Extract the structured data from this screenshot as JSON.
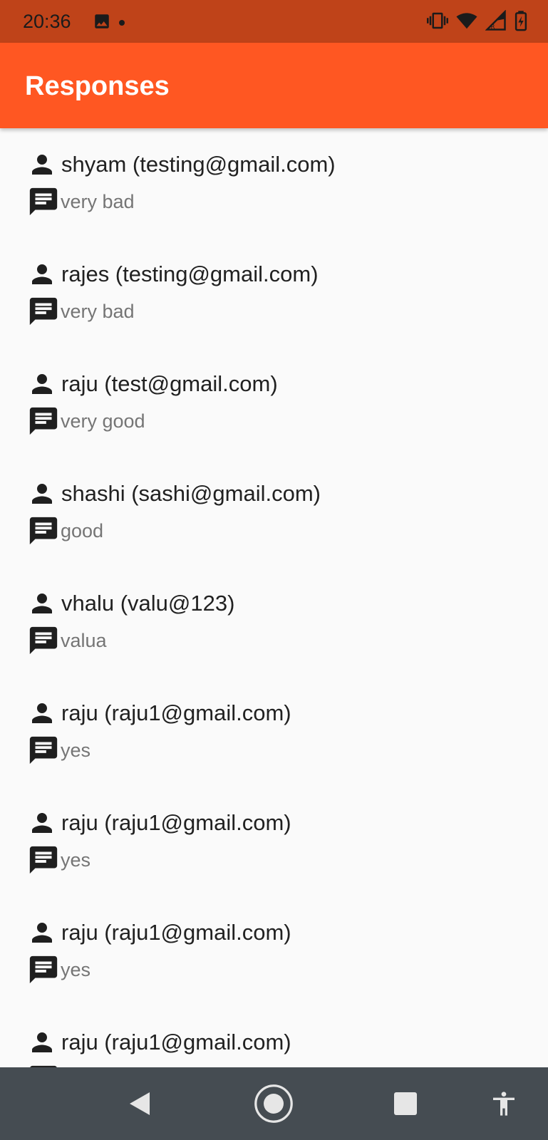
{
  "status_bar": {
    "time": "20:36",
    "icons": [
      "image-icon",
      "notification-dot-icon",
      "vibrate-icon",
      "wifi-icon",
      "signal-roaming-icon",
      "battery-charging-icon"
    ],
    "color": "#bf4319"
  },
  "app_bar": {
    "title": "Responses",
    "color": "#ff5722"
  },
  "responses": [
    {
      "name": "shyam (testing@gmail.com)",
      "message": "very bad"
    },
    {
      "name": "rajes (testing@gmail.com)",
      "message": "very bad"
    },
    {
      "name": "raju (test@gmail.com)",
      "message": "very good"
    },
    {
      "name": "shashi (sashi@gmail.com)",
      "message": "good"
    },
    {
      "name": "vhalu (valu@123)",
      "message": "valua"
    },
    {
      "name": "raju (raju1@gmail.com)",
      "message": "yes"
    },
    {
      "name": "raju (raju1@gmail.com)",
      "message": "yes"
    },
    {
      "name": "raju (raju1@gmail.com)",
      "message": "yes"
    },
    {
      "name": "raju (raju1@gmail.com)",
      "message": ""
    }
  ],
  "nav_bar": {
    "buttons": [
      "back-icon",
      "home-icon",
      "recents-icon",
      "accessibility-icon"
    ],
    "color": "#454c52"
  }
}
